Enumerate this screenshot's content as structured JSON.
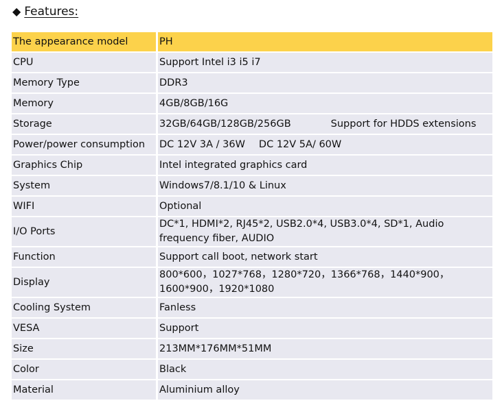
{
  "heading": {
    "bullet": "◆",
    "title": "Features:"
  },
  "rows": [
    {
      "label": "The appearance model",
      "value": "PH"
    },
    {
      "label": "CPU",
      "value": "Support Intel i3 i5 i7"
    },
    {
      "label": "Memory Type",
      "value": "DDR3"
    },
    {
      "label": "Memory",
      "value": "4GB/8GB/16G"
    },
    {
      "label": "Storage",
      "value": "32GB/64GB/128GB/256GB",
      "value2": "Support for HDDS extensions"
    },
    {
      "label": "Power/power consumption",
      "value": "DC 12V 3A / 36W",
      "value2": "DC 12V 5A/ 60W"
    },
    {
      "label": "Graphics Chip",
      "value": "Intel integrated graphics card"
    },
    {
      "label": "System",
      "value": "Windows7/8.1/10 & Linux"
    },
    {
      "label": "WIFI",
      "value": "Optional"
    },
    {
      "label": "I/O Ports",
      "value": "DC*1, HDMI*2, RJ45*2, USB2.0*4, USB3.0*4, SD*1, Audio",
      "value2": "frequency fiber, AUDIO"
    },
    {
      "label": "Function",
      "value": "Support call boot, network start"
    },
    {
      "label": "Display",
      "value": "800*600，1027*768，1280*720，1366*768，1440*900，",
      "value2": "1600*900，1920*1080"
    },
    {
      "label": "Cooling System",
      "value": "Fanless"
    },
    {
      "label": "VESA",
      "value": "Support"
    },
    {
      "label": "Size",
      "value": "213MM*176MM*51MM"
    },
    {
      "label": "Color",
      "value": "Black"
    },
    {
      "label": "Material",
      "value": "Aluminium alloy"
    }
  ]
}
